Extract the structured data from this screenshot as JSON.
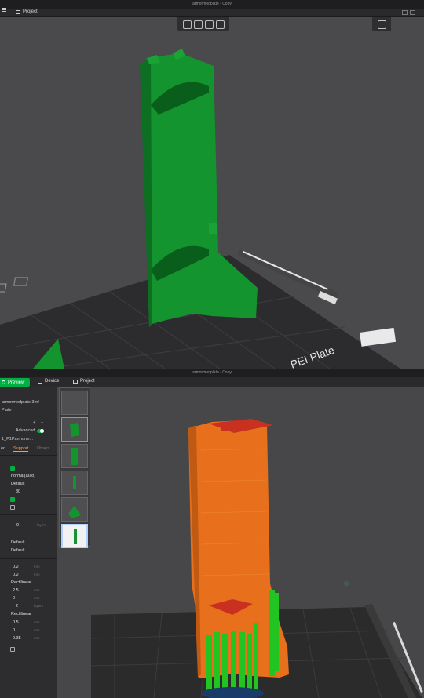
{
  "window_top": {
    "title": "armormodplate - Copy",
    "menu": {
      "project_label": "Project"
    },
    "bed_label": "PEI Plate"
  },
  "window_bottom": {
    "title": "armormodplate - Copy",
    "nav": {
      "preview_label": "Preview",
      "device_label": "Device",
      "project_label": "Project"
    },
    "sidebar": {
      "file_name": "armormodplate.3mf",
      "plate_label": "Plate",
      "advanced_label": "Advanced",
      "object_label": "1_P1Parmorm...",
      "tabs": {
        "quality": "ed",
        "support": "Support",
        "others": "Others"
      },
      "rows": {
        "type_value": "normal(auto)",
        "style_value": "Default",
        "threshold_value": "30",
        "raft_value": "0",
        "raft_unit": "layers",
        "default_a": "Default",
        "default_b": "Default",
        "top_z": "0.2",
        "bottom_z": "0.2",
        "z_unit": "mm",
        "pattern_value": "Rectilinear",
        "spacing_value": "2.5",
        "zero_value": "0",
        "two_value": "2",
        "two_unit": "layers",
        "iface_pattern": "Rectilinear",
        "iface_spacing": "0.5",
        "zero_b": "0",
        "xy_value": "0.35"
      },
      "units_mm": "mm"
    }
  },
  "colors": {
    "accent_green": "#00ae42",
    "model_green": "#14942e",
    "model_orange": "#e8701c",
    "support_green": "#22c422",
    "top_red": "#c83020",
    "bed": "#2b2b2b"
  }
}
